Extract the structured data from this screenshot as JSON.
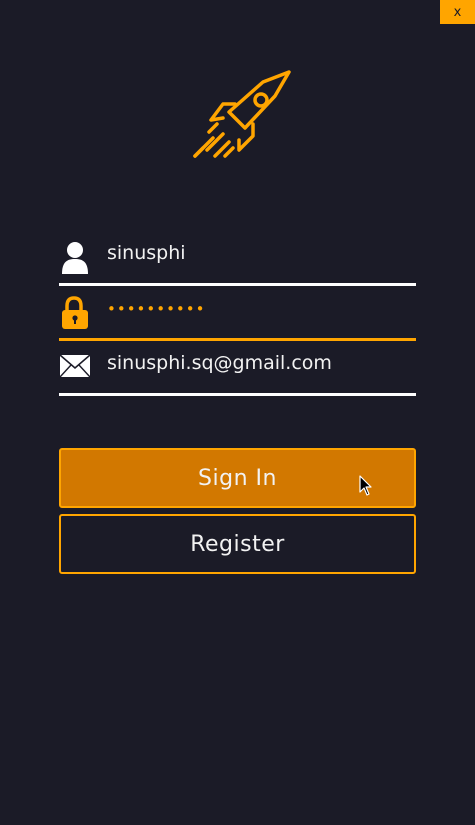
{
  "window": {
    "close_label": "x"
  },
  "logo": {
    "icon": "rocket-icon",
    "color": "#ffa500"
  },
  "form": {
    "username": {
      "icon": "user-icon",
      "value": "sinusphi"
    },
    "password": {
      "icon": "lock-icon",
      "value": "••••••••••"
    },
    "email": {
      "icon": "envelope-icon",
      "value": "sinusphi.sq@gmail.com"
    }
  },
  "actions": {
    "sign_in_label": "Sign In",
    "register_label": "Register"
  },
  "colors": {
    "background": "#1b1b27",
    "accent": "#ffa500",
    "primary_button": "#d27800",
    "text": "#f2f2f2"
  }
}
